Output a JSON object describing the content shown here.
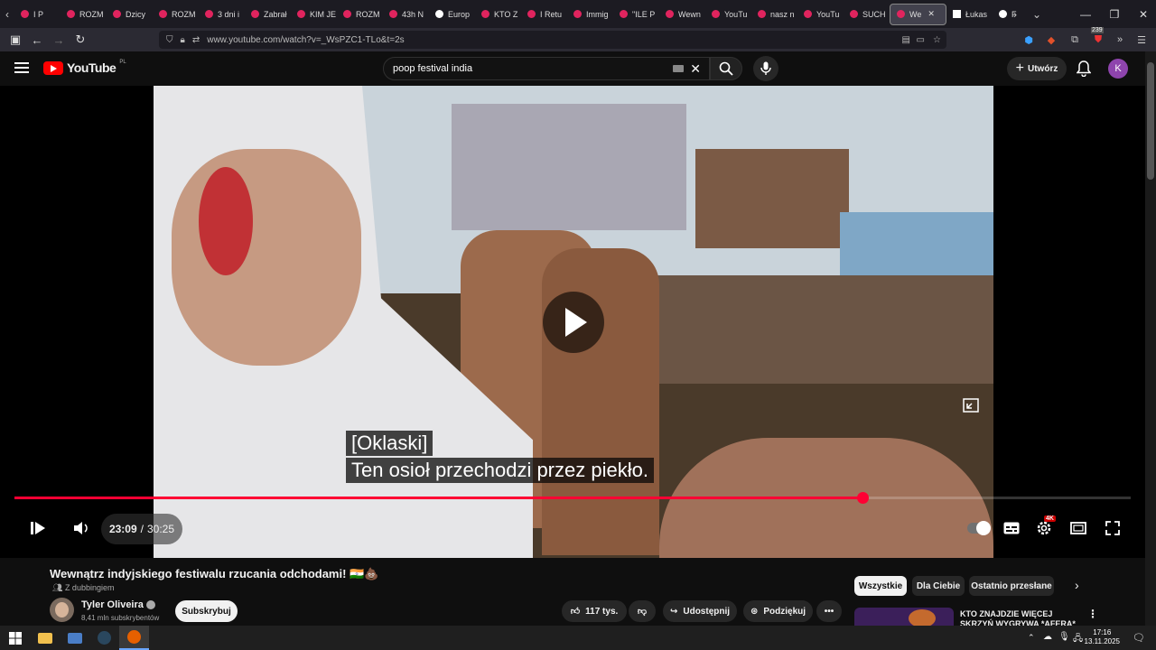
{
  "browser": {
    "tabs": [
      {
        "label": "I P"
      },
      {
        "label": "ROZM"
      },
      {
        "label": "Dzicy"
      },
      {
        "label": "ROZM"
      },
      {
        "label": "3 dni i"
      },
      {
        "label": "Zabrał"
      },
      {
        "label": "KIM JE"
      },
      {
        "label": "ROZM"
      },
      {
        "label": "43h N"
      },
      {
        "label": "Europ"
      },
      {
        "label": "KTO Z"
      },
      {
        "label": "I Retu"
      },
      {
        "label": "Immig"
      },
      {
        "label": "\"ILE P"
      },
      {
        "label": "Wewn"
      },
      {
        "label": "YouTu"
      },
      {
        "label": "nasz n"
      },
      {
        "label": "YouTu"
      },
      {
        "label": "SUCH"
      },
      {
        "label": "We"
      },
      {
        "label": "Łukas"
      },
      {
        "label": "Filmy"
      }
    ],
    "url": "www.youtube.com/watch?v=_WsPZC1-TLo&t=2s",
    "ext_badge": "239"
  },
  "youtube": {
    "logo_text": "YouTube",
    "country": "PL",
    "search_value": "poop festival india",
    "create_label": "Utwórz",
    "avatar_letter": "K"
  },
  "player": {
    "subtitle_line1": "[Oklaski]",
    "subtitle_line2": "Ten osioł przechodzi przez piekło.",
    "time_current": "23:09",
    "time_separator": "/",
    "time_total": "30:25",
    "progress_fraction": 0.76,
    "quality_badge": "4K"
  },
  "video": {
    "title": "Wewnątrz indyjskiego festiwalu rzucania odchodami! 🇮🇳💩",
    "dubbing": "Z dubbingiem",
    "channel_name": "Tyler Oliveira",
    "channel_subs": "8,41 mln subskrybentów",
    "subscribe_label": "Subskrybuj",
    "likes": "117 tys.",
    "share_label": "Udostępnij",
    "thanks_label": "Podziękuj"
  },
  "chips": [
    {
      "label": "Wszystkie"
    },
    {
      "label": "Dla Ciebie"
    },
    {
      "label": "Ostatnio przesłane"
    }
  ],
  "recommendation": {
    "title": "KTO ZNAJDZIE WIĘCEJ SKRZYŃ WYGRYWA *AFERA*"
  },
  "taskbar": {
    "time": "17:16",
    "date": "13.11.2025"
  },
  "colors": {
    "accent_red": "#ff0033",
    "yt_red": "#ff0000",
    "background": "#0f0f0f"
  }
}
